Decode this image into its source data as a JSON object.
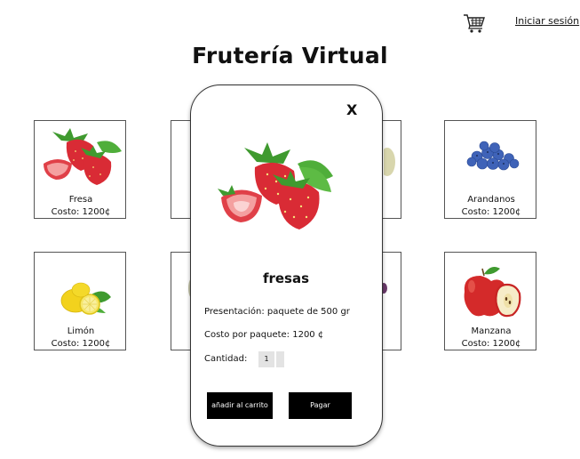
{
  "header": {
    "cart_icon": "shopping-cart-icon",
    "login_label": "Iniciar sesión",
    "title": "Frutería Virtual"
  },
  "products": [
    {
      "name": "Fresa",
      "cost": "Costo: 1200¢",
      "icon": "strawberry-image"
    },
    {
      "name": "Arandanos",
      "cost": "Costo: 1200¢",
      "icon": "blueberries-image"
    },
    {
      "name": "Limón",
      "cost": "Costo: 1200¢",
      "icon": "lemon-image"
    },
    {
      "name": "Manzana",
      "cost": "Costo: 1200¢",
      "icon": "apple-image"
    }
  ],
  "modal": {
    "close_label": "X",
    "title": "fresas",
    "image": "strawberry-image",
    "presentation": "Presentación: paquete de 500 gr",
    "package_cost": "Costo por paquete: 1200 ¢",
    "quantity_label": "Cantidad:",
    "quantity_value": "1",
    "add_to_cart_label": "añadir al carrito",
    "pay_label": "Pagar"
  },
  "colors": {
    "accent": "#000000",
    "strawberry": "#d92b35",
    "leaf": "#3f9a2f",
    "blueberry": "#3f63b8",
    "lemon": "#f2d21d",
    "apple": "#d42a2a"
  }
}
